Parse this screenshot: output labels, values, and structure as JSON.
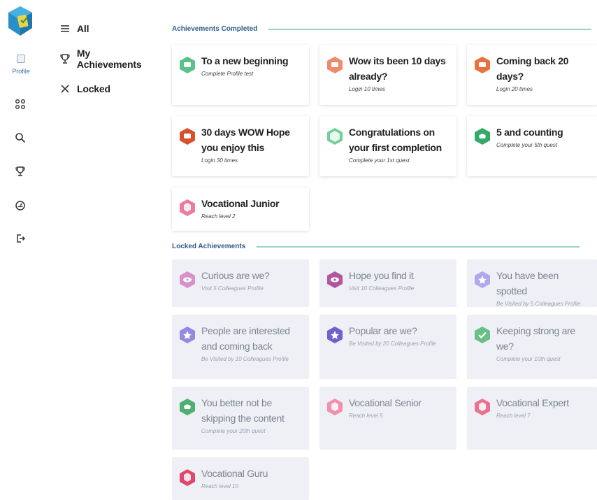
{
  "sidebar": {
    "profile_label": "Profile"
  },
  "menu": {
    "items": [
      {
        "label": "All",
        "icon": "list-icon"
      },
      {
        "label": "My Achievements",
        "icon": "trophy-icon"
      },
      {
        "label": "Locked",
        "icon": "close-icon"
      }
    ]
  },
  "sections": {
    "completed_title": "Achievements Completed",
    "locked_title": "Locked Achievements"
  },
  "completed": [
    {
      "title": "To a new beginning",
      "subtitle": "Complete Profile test",
      "color": "#5cc08a",
      "icon": "chat-hex-icon"
    },
    {
      "title": "Wow its been 10 days already?",
      "subtitle": "Login 10 times",
      "color": "#ef8a6a",
      "icon": "chat-hex-icon"
    },
    {
      "title": "Coming back 20 days?",
      "subtitle": "Login 20 times",
      "color": "#e9703f",
      "icon": "chat-hex-icon"
    },
    {
      "title": "30 days WOW Hope you enjoy this",
      "subtitle": "Login 30 times",
      "color": "#d9502e",
      "icon": "chat-hex-icon"
    },
    {
      "title": "Congratulations on your first completion",
      "subtitle": "Complete your 1st quest",
      "color": "#6fcf95",
      "icon": "check-hex-icon"
    },
    {
      "title": "5 and counting",
      "subtitle": "Complete your 5th quest",
      "color": "#35a96a",
      "icon": "check-hex-icon"
    },
    {
      "title": "Vocational Junior",
      "subtitle": "Reach level 2",
      "color": "#ea7ba1",
      "icon": "level-hex-icon"
    }
  ],
  "locked": [
    {
      "title": "Curious are we?",
      "subtitle": "Visit 5 Colleagues Profile",
      "color": "#d692c9",
      "icon": "eye-hex-icon"
    },
    {
      "title": "Hope you find it",
      "subtitle": "Visit 10 Colleagues Profile",
      "color": "#b2579f",
      "icon": "eye-hex-icon"
    },
    {
      "title": "You have been spotted",
      "subtitle": "Be Visited by 5 Colleagues Profile",
      "color": "#b2a6ef",
      "icon": "star-hex-icon"
    },
    {
      "title": "People are interested and coming back",
      "subtitle": "Be Visited by 10 Colleagues Profile",
      "color": "#9588e4",
      "icon": "star-hex-icon"
    },
    {
      "title": "Popular are we?",
      "subtitle": "Be Visited by 20 Colleagues Profile",
      "color": "#6f5fcf",
      "icon": "star-hex-icon"
    },
    {
      "title": "Keeping strong are we?",
      "subtitle": "Complete your 10th quest",
      "color": "#68bf88",
      "icon": "check-hex-icon"
    },
    {
      "title": "You better not be skipping the content",
      "subtitle": "Complete your 20th quest",
      "color": "#4fae72",
      "icon": "check-hex-icon"
    },
    {
      "title": "Vocational Senior",
      "subtitle": "Reach level 5",
      "color": "#ef90ad",
      "icon": "level-hex-icon"
    },
    {
      "title": "Vocational Expert",
      "subtitle": "Reach level 7",
      "color": "#e9738f",
      "icon": "level-hex-icon"
    },
    {
      "title": "Vocational Guru",
      "subtitle": "Reach level 10",
      "color": "#e2466c",
      "icon": "level-hex-icon"
    }
  ]
}
